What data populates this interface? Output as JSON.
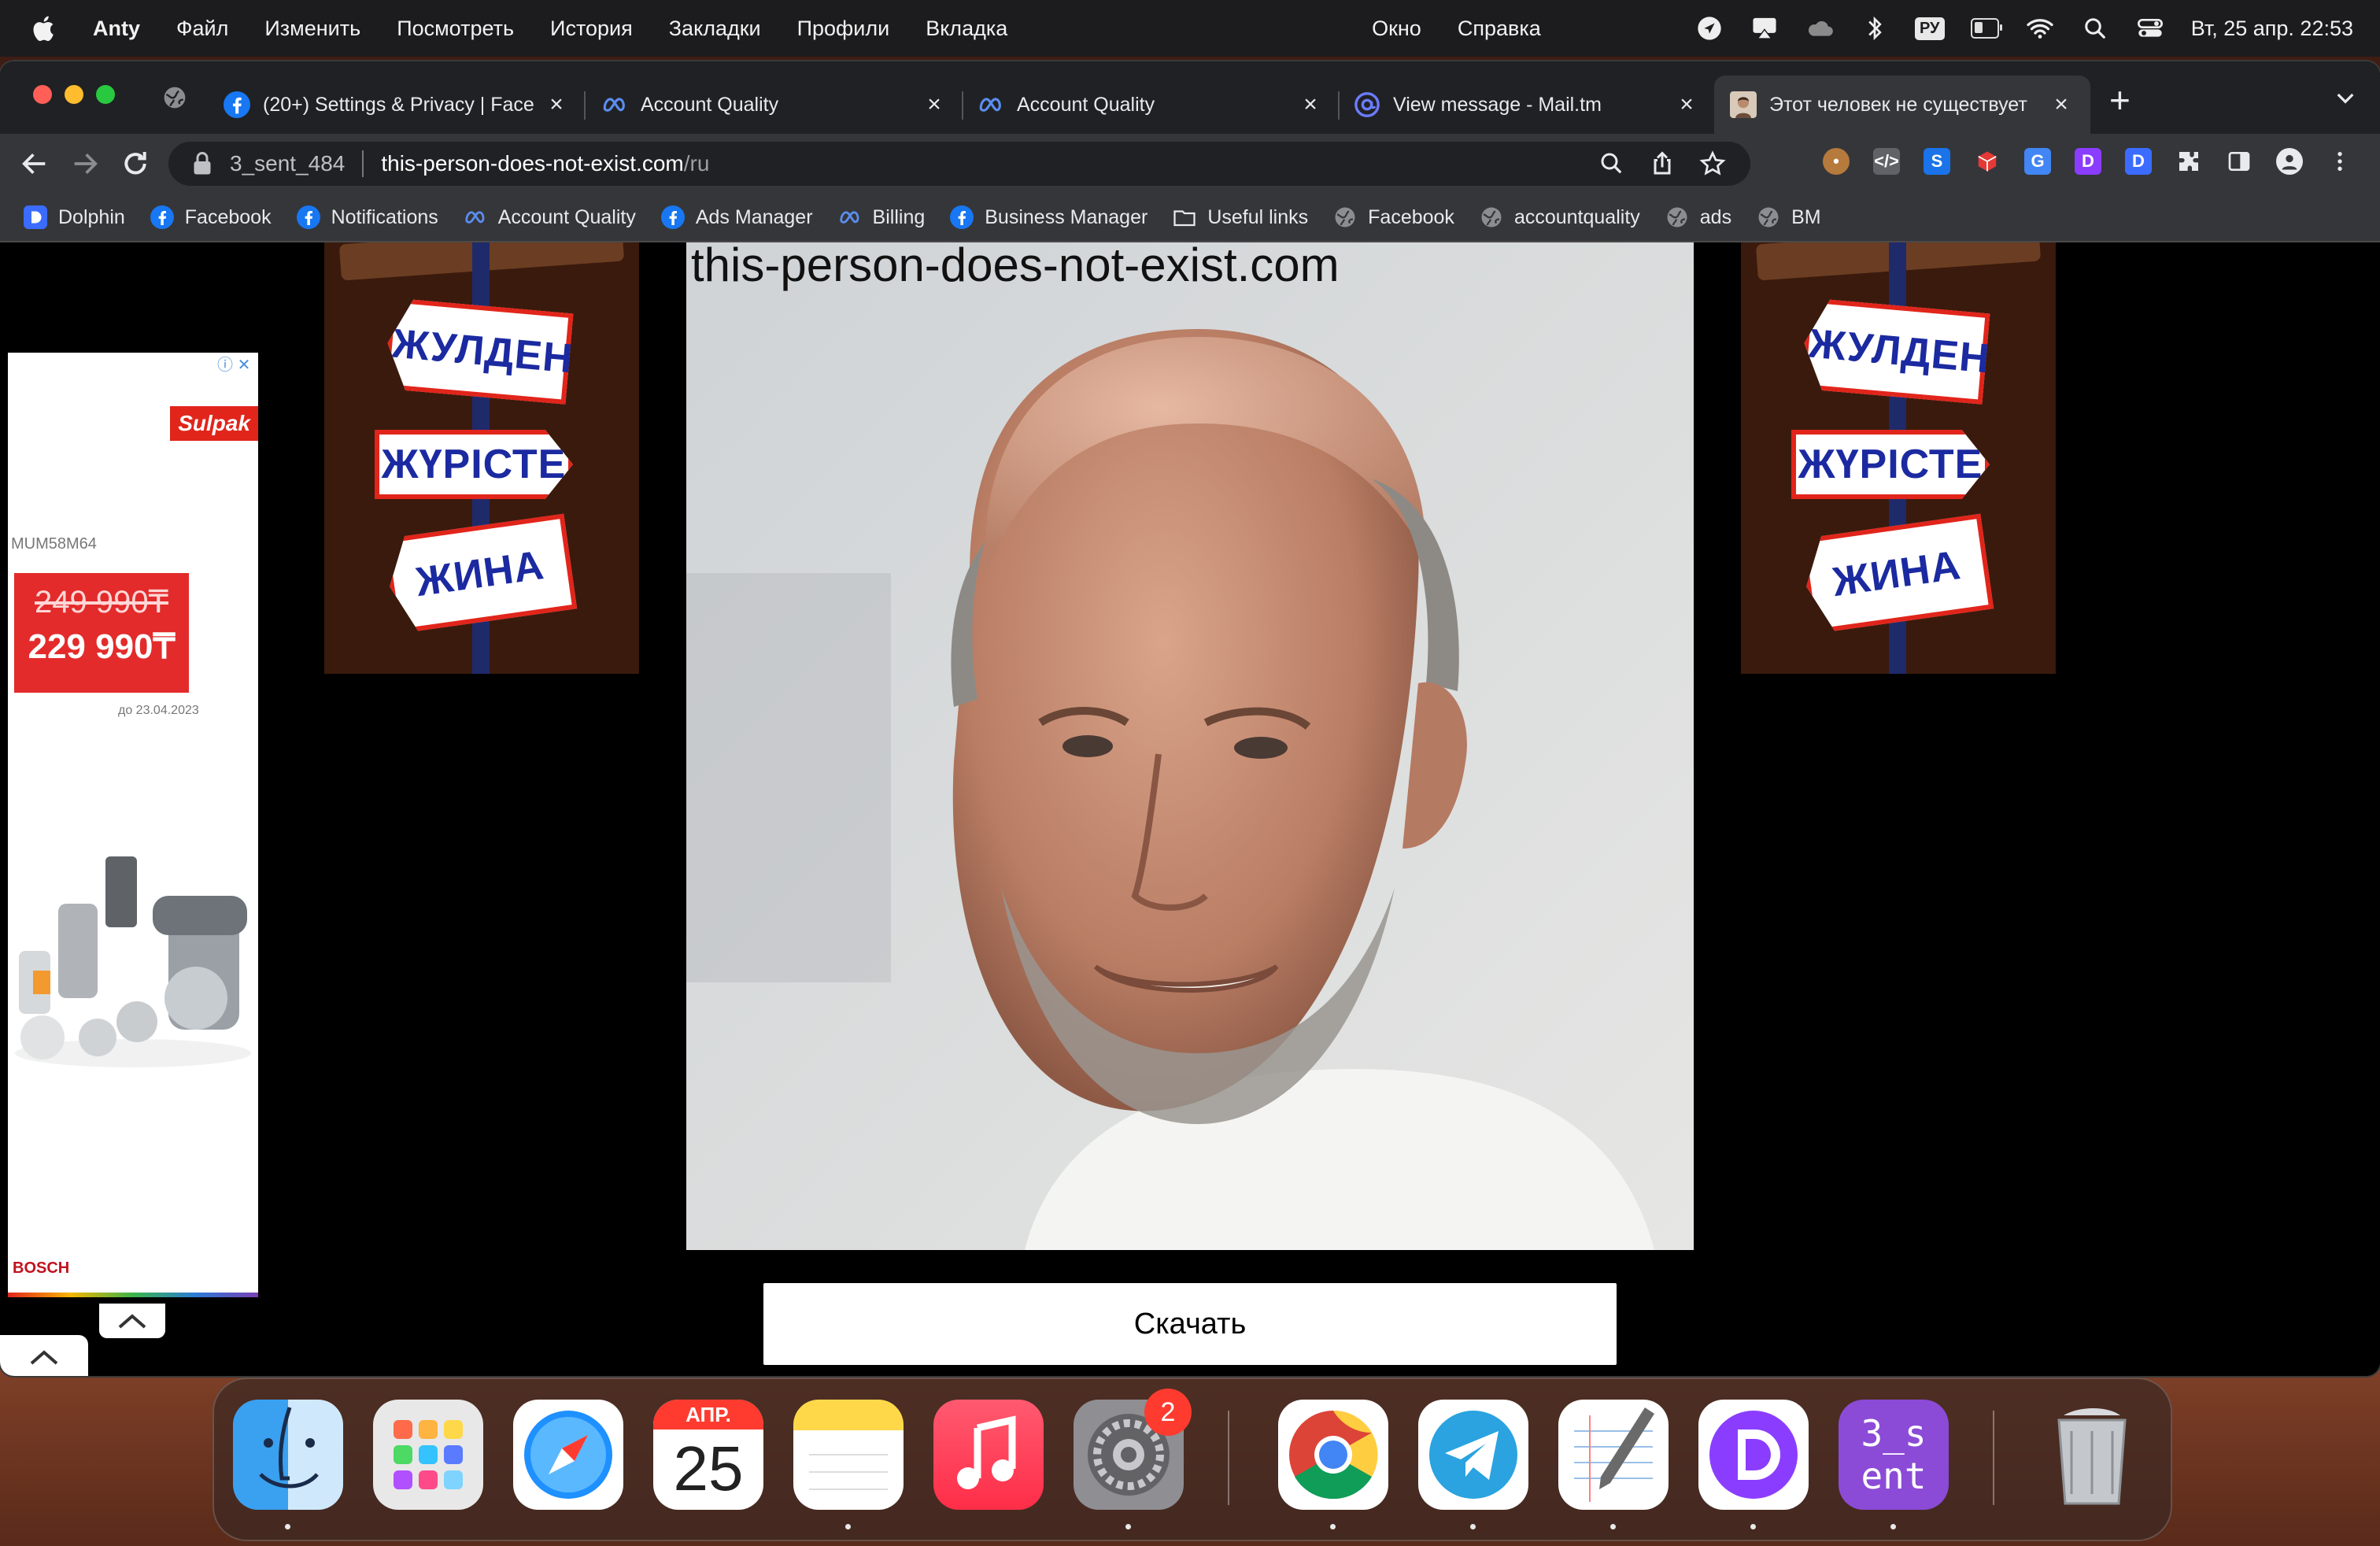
{
  "menubar": {
    "app_name": "Anty",
    "items": [
      "Файл",
      "Изменить",
      "Посмотреть",
      "История",
      "Закладки",
      "Профили",
      "Вкладка"
    ],
    "right_items": [
      "Окно",
      "Справка"
    ],
    "keyboard_layout": "РУ",
    "clock": "Вт, 25 апр.  22:53"
  },
  "tabs": [
    {
      "title": "(20+) Settings & Privacy | Face",
      "icon": "facebook-icon"
    },
    {
      "title": "Account Quality",
      "icon": "meta-icon"
    },
    {
      "title": "Account Quality",
      "icon": "meta-icon"
    },
    {
      "title": "View message - Mail.tm",
      "icon": "mail-icon"
    },
    {
      "title": "Этот человек не существует",
      "icon": "avatar-icon",
      "active": true
    }
  ],
  "address": {
    "profile": "3_sent_484",
    "host": "this-person-does-not-exist.com",
    "path": "/ru"
  },
  "bookmarks": [
    {
      "label": "Dolphin",
      "icon": "dolphin-icon"
    },
    {
      "label": "Facebook",
      "icon": "facebook-icon"
    },
    {
      "label": "Notifications",
      "icon": "facebook-icon"
    },
    {
      "label": "Account Quality",
      "icon": "meta-icon"
    },
    {
      "label": "Ads Manager",
      "icon": "facebook-icon"
    },
    {
      "label": "Billing",
      "icon": "meta-icon"
    },
    {
      "label": "Business Manager",
      "icon": "facebook-icon"
    },
    {
      "label": "Useful links",
      "icon": "folder-icon"
    },
    {
      "label": "Facebook",
      "icon": "globe-icon"
    },
    {
      "label": "accountquality",
      "icon": "globe-icon"
    },
    {
      "label": "ads",
      "icon": "globe-icon"
    },
    {
      "label": "BM",
      "icon": "globe-icon"
    }
  ],
  "page": {
    "watermark": "this-person-does-not-exist.com",
    "download_label": "Скачать"
  },
  "ad": {
    "brand": "Sulpak",
    "model": "MUM58M64",
    "old_price": "249 990₸",
    "new_price": "229 990₸",
    "until": "до 23.04.2023",
    "maker": "BOSCH"
  },
  "banner": {
    "signs": [
      "ЖУЛДЕНІ",
      "ЖҮРІСТЕ",
      "ЖИНА"
    ]
  },
  "dock": {
    "calendar_month": "АПР.",
    "calendar_day": "25",
    "settings_badge": "2",
    "profile_tile": "3_s ent"
  },
  "colors": {
    "chrome_dark": "#202124",
    "chrome_toolbar": "#35363a",
    "sign_text": "#1b2aa0",
    "sign_border": "#e1251b",
    "sulpak_red": "#e1251b"
  }
}
